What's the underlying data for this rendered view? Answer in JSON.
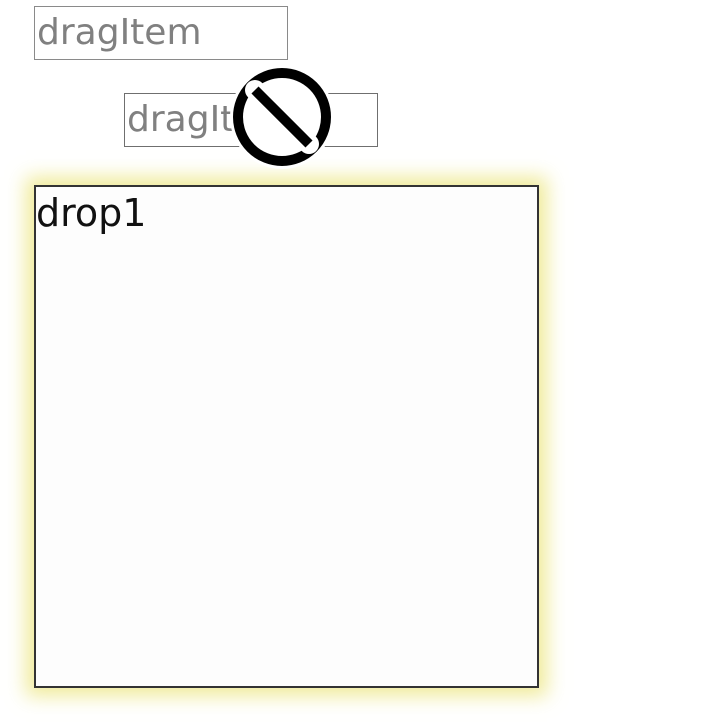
{
  "drag_items": [
    {
      "label": "dragItem"
    },
    {
      "label": "dragItem"
    }
  ],
  "cursor": {
    "icon": "no-drop-icon"
  },
  "drop_zone": {
    "label": "drop1",
    "highlight_color": "#ebe478"
  }
}
